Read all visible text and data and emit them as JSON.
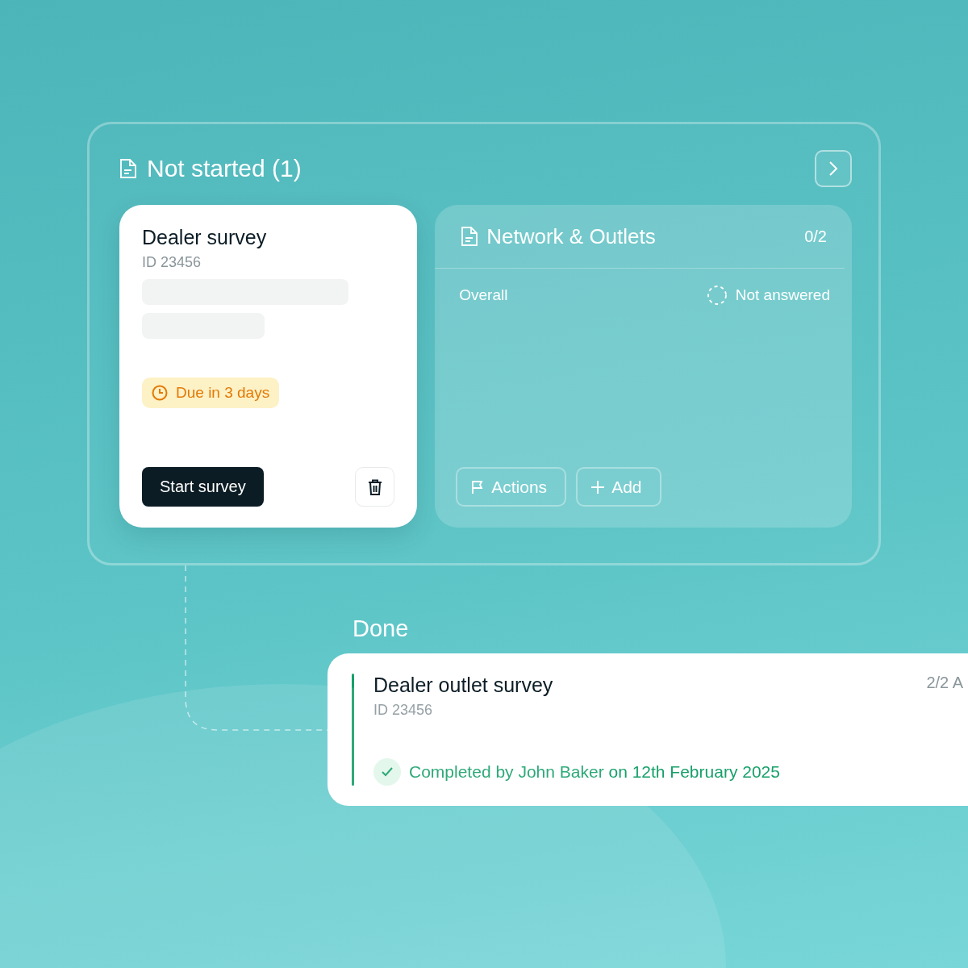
{
  "not_started": {
    "title": "Not started (1)",
    "survey": {
      "title": "Dealer survey",
      "id": "ID 23456",
      "due": "Due in 3 days",
      "start_button": "Start survey"
    },
    "section": {
      "title": "Network & Outlets",
      "progress": "0/2",
      "row": {
        "label": "Overall",
        "status": "Not answered"
      },
      "buttons": [
        {
          "label": "Actions",
          "kind": "flag"
        },
        {
          "label": "Add",
          "kind": "plus"
        }
      ]
    }
  },
  "done": {
    "title": "Done",
    "survey": {
      "title": "Dealer outlet survey",
      "id": "ID 23456",
      "progress": "2/2 A",
      "completed": "Completed by John Baker on 12th February 2025"
    }
  }
}
